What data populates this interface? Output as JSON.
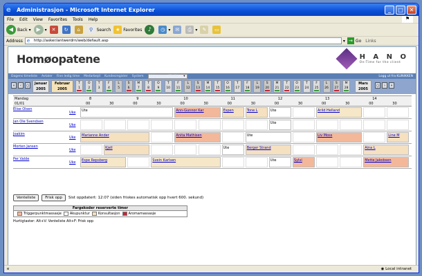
{
  "window": {
    "title": "Administrasjon - Microsoft Internet Explorer"
  },
  "menu": [
    "File",
    "Edit",
    "View",
    "Favorites",
    "Tools",
    "Help"
  ],
  "toolbar": {
    "back": "Back",
    "search": "Search",
    "favorites": "Favorites"
  },
  "address": {
    "label": "Address",
    "url": "http://asker/antwerdrn/web/default.asp",
    "go": "Go",
    "links": "Links"
  },
  "status": {
    "zone": "Local intranet"
  },
  "app": {
    "logo": "Homøopatene",
    "brand": "H A N O",
    "tagline": "On-Time for the client"
  },
  "nav": {
    "items": [
      "Dagens timeliste",
      "Avtaler",
      "Finn ledig time",
      "Medarbejd",
      "Kundesregister",
      "System"
    ],
    "clinic_label": "Velg annen Klinikk",
    "right": "Logg ut fra KLINIKKEN"
  },
  "calendar": {
    "month1": "Januar",
    "year1": "2005",
    "month2": "Februar",
    "year2": "2005",
    "month3": "Mars",
    "year3": "2005",
    "days": [
      {
        "d": "T",
        "n": "1"
      },
      {
        "d": "O",
        "n": "2"
      },
      {
        "d": "T",
        "n": "3"
      },
      {
        "d": "F",
        "n": "4"
      },
      {
        "d": "L",
        "n": "5"
      },
      {
        "d": "S",
        "n": "6"
      },
      {
        "d": "M",
        "n": "7"
      },
      {
        "d": "T",
        "n": "8"
      },
      {
        "d": "O",
        "n": "9"
      },
      {
        "d": "T",
        "n": "10"
      },
      {
        "d": "F",
        "n": "11"
      },
      {
        "d": "L",
        "n": "12"
      },
      {
        "d": "S",
        "n": "13"
      },
      {
        "d": "M",
        "n": "14"
      },
      {
        "d": "T",
        "n": "15"
      },
      {
        "d": "O",
        "n": "16"
      },
      {
        "d": "T",
        "n": "17"
      },
      {
        "d": "F",
        "n": "18"
      },
      {
        "d": "L",
        "n": "19"
      },
      {
        "d": "S",
        "n": "20"
      },
      {
        "d": "M",
        "n": "21"
      },
      {
        "d": "T",
        "n": "22"
      },
      {
        "d": "O",
        "n": "23"
      },
      {
        "d": "T",
        "n": "24"
      },
      {
        "d": "F",
        "n": "25"
      },
      {
        "d": "L",
        "n": "26"
      },
      {
        "d": "S",
        "n": "27"
      },
      {
        "d": "M",
        "n": "28"
      }
    ]
  },
  "schedule": {
    "day": "Mandag",
    "date": "01/01",
    "hours": [
      "8",
      "9",
      "10",
      "11",
      "12",
      "13",
      "14"
    ],
    "minutes": [
      "00",
      "30",
      "00",
      "30",
      "00",
      "30",
      "00",
      "30",
      "00",
      "30",
      "00",
      "30",
      "00",
      "30"
    ],
    "uke": "Uke",
    "people": [
      {
        "name": "Elise Olsen",
        "slots": [
          {
            "t": "Ute"
          },
          {
            "t": "Ann-Gunnor Kar",
            "link": true,
            "c": "#f3b89a"
          },
          {
            "t": "Espen",
            "link": true,
            "c": "#f5e0c0"
          },
          {
            "t": "Tone L",
            "link": true,
            "c": "#f5e0c0"
          },
          {
            "t": "Ute"
          },
          {
            "t": "Arild Helland",
            "link": true,
            "c": "#f5e7c8"
          }
        ]
      },
      {
        "name": "Jan Ole Svendsen",
        "slots": [
          {
            "t": "Ute"
          }
        ]
      },
      {
        "name": "Joakim",
        "slots": [
          {
            "t": "Marianne Ander",
            "link": true,
            "c": "#f5e0c0"
          },
          {
            "t": "Anita Mathisen",
            "link": true,
            "c": "#f3b89a"
          },
          {
            "t": "Ute"
          },
          {
            "t": "Liv Moss",
            "link": true,
            "c": "#f3b89a"
          },
          {
            "t": "Line M",
            "link": true,
            "c": "#f5e0c0"
          }
        ]
      },
      {
        "name": "Morten Jansen",
        "slots": [
          {
            "t": "Kjell",
            "link": true,
            "c": "#f5e0c0"
          },
          {
            "t": "Ute"
          },
          {
            "t": "Berger Strand",
            "link": true,
            "c": "#f5e0c0"
          },
          {
            "t": "Aina L",
            "link": true,
            "c": "#f5e0c0"
          }
        ]
      },
      {
        "name": "Per Valde",
        "slots": [
          {
            "t": "Espe Repsberg",
            "link": true,
            "c": "#f5e7c8"
          },
          {
            "t": "Svein Karlsen",
            "link": true,
            "c": "#f5e7c8"
          },
          {
            "t": "Ute"
          },
          {
            "t": "Sylvi",
            "link": true,
            "c": "#f3b89a"
          },
          {
            "t": "Mette Jakobsen",
            "link": true,
            "c": "#f3b89a"
          }
        ]
      }
    ]
  },
  "actions": {
    "ventelist": "Venteliste",
    "refresh": "Frisk opp",
    "updated": "Sist oppdatert: 12:07 (siden friskes automatisk opp hvert 600. sekund)"
  },
  "legend": {
    "title": "Fargekoder reserverte timer",
    "items": [
      {
        "label": "Triggerpunktmassasje",
        "color": "#f3b89a"
      },
      {
        "label": "Akupunktur",
        "color": "#ffffff"
      },
      {
        "label": "Konsultasjon",
        "color": "#f5e0c0"
      },
      {
        "label": "Aromamassasje",
        "color": "#c0283a"
      }
    ]
  },
  "hurtig": "Hurtigtaster:   Alt+V: Venteliste   Alt+F: Frisk opp"
}
